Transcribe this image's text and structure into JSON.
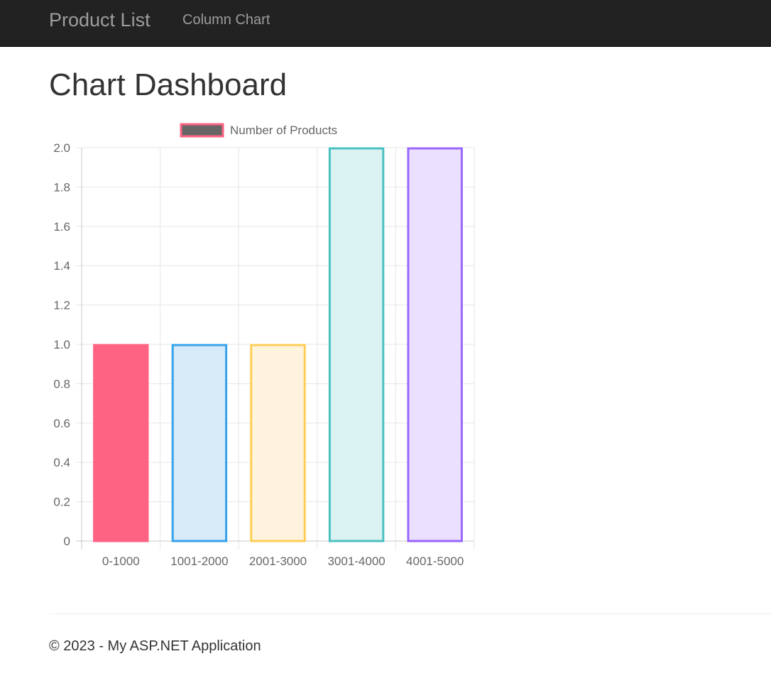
{
  "navbar": {
    "brand": "Product List",
    "links": [
      "Column Chart"
    ]
  },
  "page": {
    "title": "Chart Dashboard"
  },
  "chart_data": {
    "type": "bar",
    "legend": {
      "label": "Number of Products",
      "position": "top"
    },
    "categories": [
      "0-1000",
      "1001-2000",
      "2001-3000",
      "3001-4000",
      "4001-5000"
    ],
    "series": [
      {
        "name": "Number of Products",
        "values": [
          1,
          1,
          1,
          2,
          2
        ]
      }
    ],
    "ylim": [
      0,
      2
    ],
    "yticks": [
      "0",
      "0.2",
      "0.4",
      "0.6",
      "0.8",
      "1.0",
      "1.2",
      "1.4",
      "1.6",
      "1.8",
      "2.0"
    ],
    "grid": true,
    "bar_colors": {
      "fill": [
        "#ff6384",
        "#d6eaf8",
        "#fef3dc",
        "#dbf2f2",
        "#ebe0ff"
      ],
      "border": [
        "#ff6384",
        "#36a2eb",
        "#ffcd56",
        "#4bc0c0",
        "#9966ff"
      ]
    },
    "legend_colors": {
      "fill": "#666666",
      "border": "#ff6384"
    },
    "grid_color": "#e5e5e5"
  },
  "footer": {
    "text": "© 2023 - My ASP.NET Application"
  }
}
